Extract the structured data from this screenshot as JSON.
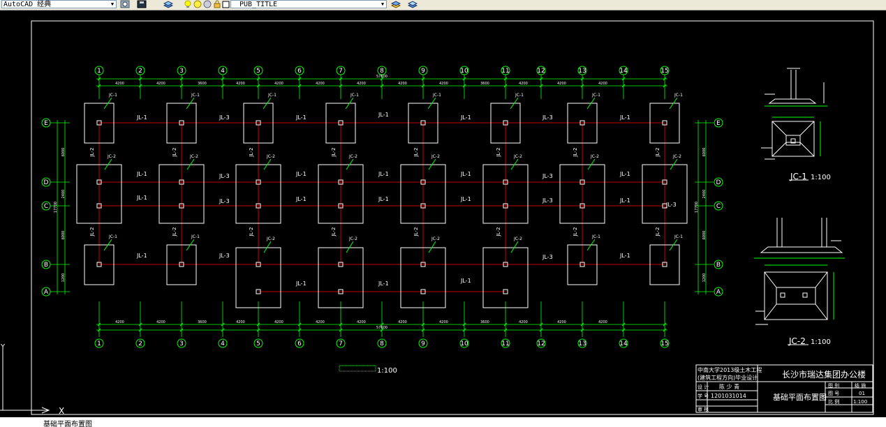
{
  "toolbar": {
    "workspace": "AutoCAD 经典",
    "layer": "PUB_TITLE"
  },
  "drawing": {
    "axes_top": [
      "1",
      "2",
      "3",
      "4",
      "5",
      "6",
      "7",
      "8",
      "9",
      "10",
      "11",
      "12",
      "13",
      "14",
      "15"
    ],
    "axes_side": [
      "E",
      "D",
      "C",
      "B",
      "A"
    ],
    "dims_top": [
      "4200",
      "4200",
      "3600",
      "4200",
      "4200",
      "4200",
      "4200",
      "4200",
      "4200",
      "3600",
      "4200",
      "4200",
      "4200"
    ],
    "total_length": "57600",
    "dims_side": [
      "6000",
      "2400",
      "6000",
      "1200"
    ],
    "side_total": "17700",
    "beam_labels": {
      "jl1": "JL-1",
      "jl2": "JL-2",
      "jl3": "JL-3"
    },
    "footing_labels": {
      "jc1": "JC-1",
      "jc2": "JC-2"
    },
    "plan_scale": "1:100",
    "detail1": {
      "title": "JC-1",
      "scale": "1:100"
    },
    "detail2": {
      "title": "JC-2",
      "scale": "1:100"
    }
  },
  "title_block": {
    "school_line1": "中南大学2013级土木工程",
    "school_line2": "(建筑工程方向)毕业设计",
    "project": "长沙市瑞达集团办公楼",
    "sheet": "基础平面布置图",
    "design_label": "设 计",
    "designer": "陈 少 青",
    "student_id": "1201031014",
    "student_label": "学 号",
    "review_label": "审 核",
    "col_drawing": "图 别",
    "col_drawing_val": "结 施",
    "col_no": "图 号",
    "col_no_val": "01",
    "col_scale": "比 例",
    "col_scale_val": "1:100"
  },
  "command_line": "基础平面布置图"
}
